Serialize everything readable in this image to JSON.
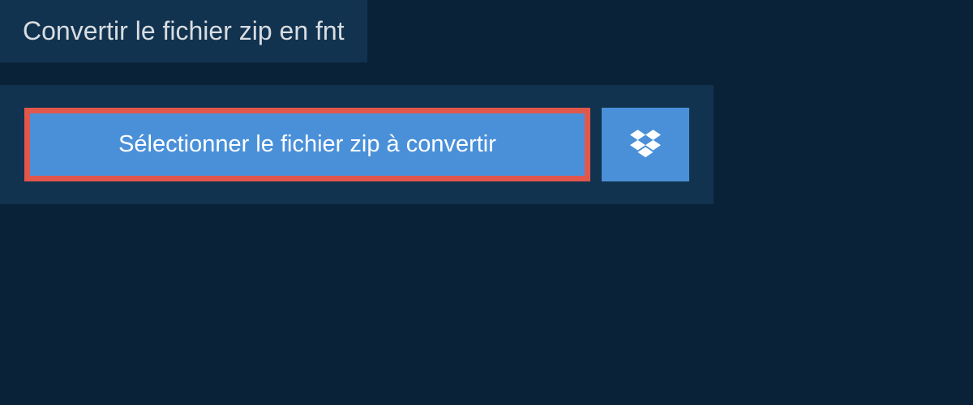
{
  "heading": {
    "title": "Convertir le fichier zip en fnt"
  },
  "actions": {
    "select_label": "Sélectionner le fichier zip à convertir"
  }
}
